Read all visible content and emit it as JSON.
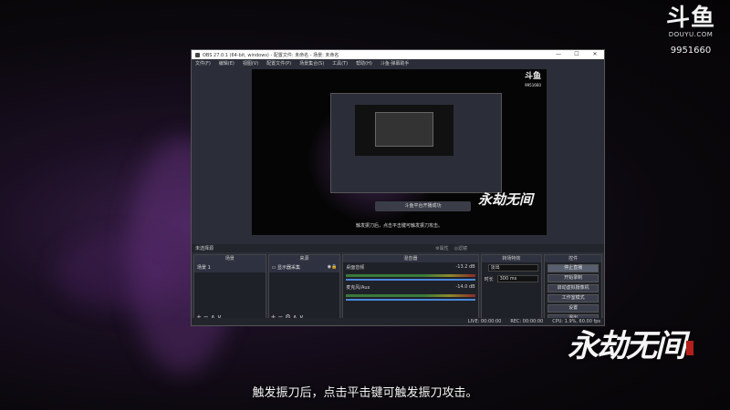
{
  "brand": {
    "logo": "斗鱼",
    "site": "DOUYU.COM",
    "room_id": "9951660"
  },
  "game_logo": "永劫无间",
  "subtitle": "触发振刀后，点击平击键可触发振刀攻击。",
  "obs": {
    "title": "OBS 27.0.1 (64-bit, windows) - 配置文件: 未命名 - 场景: 未命名",
    "window_controls": [
      "—",
      "☐",
      "✕"
    ],
    "menu": [
      "文件(F)",
      "编辑(E)",
      "视图(V)",
      "配置文件(P)",
      "场景集合(S)",
      "工具(T)",
      "帮助(H)",
      "斗鱼·弹幕助手"
    ],
    "preview": {
      "brand": "斗鱼",
      "brand_id": "9951660",
      "logo": "永劫无间",
      "toast": "斗鱼平台开播成功",
      "subtitle": "触发振刀后，点击平击键可触发振刀攻击。"
    },
    "scene_bar": {
      "label": "未选择源",
      "properties": "⚙属性",
      "filters": "◎滤镜"
    },
    "docks": {
      "scenes": {
        "header": "场景",
        "items": [
          "场景 1"
        ]
      },
      "sources": {
        "header": "来源",
        "items": [
          "显示器采集"
        ]
      },
      "mixer": {
        "header": "混音器",
        "channels": [
          {
            "name": "桌面音频",
            "db": "-13.2 dB"
          },
          {
            "name": "麦克风/Aux",
            "db": "-14.0 dB"
          }
        ]
      },
      "transitions": {
        "header": "转场特效",
        "type": "淡出",
        "duration_label": "时长",
        "duration": "300 ms"
      },
      "controls": {
        "header": "控件",
        "buttons": [
          "停止直播",
          "开始录制",
          "启动虚拟摄像机",
          "工作室模式",
          "设置",
          "退出"
        ]
      }
    },
    "status": {
      "live": "LIVE: 00:00:00",
      "rec": "REC: 00:00:00",
      "cpu": "CPU: 1.9%, 60.00 fps"
    }
  }
}
